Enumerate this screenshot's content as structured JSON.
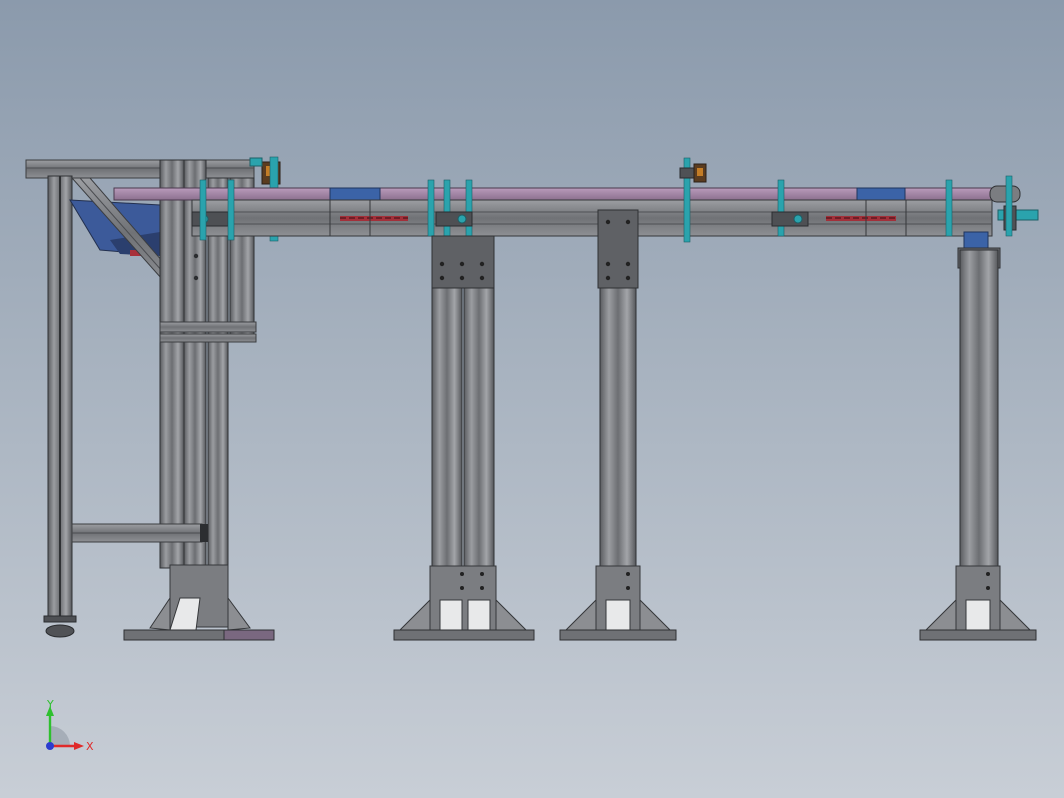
{
  "scene": {
    "background_top": "#8b9aac",
    "background_bottom": "#c8ced6",
    "frame_color": "#7f8186",
    "frame_dark": "#55575b",
    "conveyor_top_color": "#a48aa8",
    "clamp_color": "#2aa3ad",
    "guide_block_color": "#3b63a7",
    "accent_red": "#a2303a",
    "sensor_color": "#b36e1d"
  },
  "triad": {
    "x_label": "X",
    "y_label": "Y",
    "x_color": "#e02a2a",
    "y_color": "#2ec02e",
    "z_color": "#2b3ccf",
    "icons": [
      "axis-triad-icon"
    ]
  }
}
